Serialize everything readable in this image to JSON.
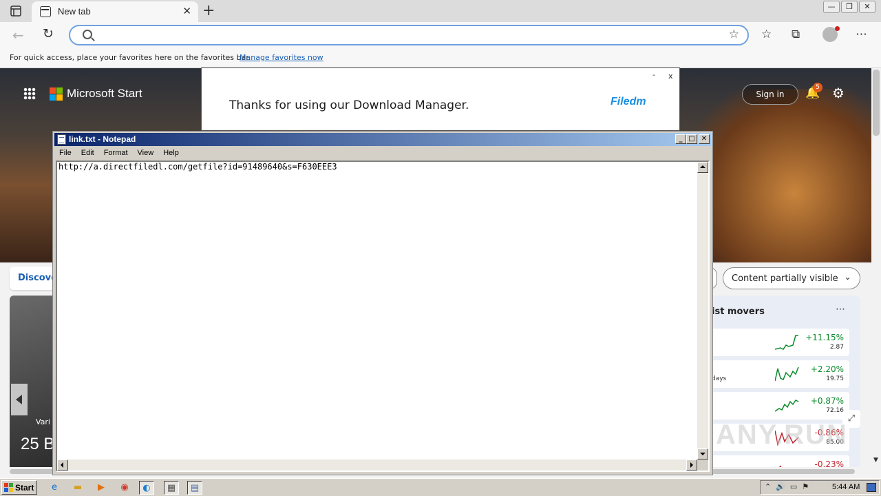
{
  "browser": {
    "tab_title": "New tab",
    "tab_close": "✕",
    "new_tab": "+",
    "address_placeholder": "",
    "favbar_text": "For quick access, place your favorites here on the favorites bar.",
    "favbar_link": "Manage favorites now"
  },
  "window_controls": {
    "minimize": "—",
    "restore": "❐",
    "close": "✕"
  },
  "start_page": {
    "brand": "Microsoft Start",
    "sign_in": "Sign in",
    "notification_count": "5",
    "discover_label": "Discove",
    "content_visibility": "Content partially visible",
    "card_source": "Vari",
    "card_headline": "25 B",
    "movers_title": "ist movers",
    "movers": [
      {
        "sub": "",
        "change": "+11.15%",
        "price": "2.87",
        "color": "#0a8a2a"
      },
      {
        "sub": "days",
        "change": "+2.20%",
        "price": "19.75",
        "color": "#0a8a2a"
      },
      {
        "sub": "",
        "change": "+0.87%",
        "price": "72.16",
        "color": "#0a8a2a"
      },
      {
        "sub": "",
        "change": "-0.86%",
        "price": "85.00",
        "color": "#c0202a"
      },
      {
        "sub": "",
        "change": "-0.23%",
        "price": "",
        "color": "#c0202a"
      }
    ],
    "watermark": "ANY.RUN"
  },
  "popup": {
    "message": "Thanks for using our Download Manager.",
    "brand": "Filedm",
    "minimize": "-",
    "close": "x"
  },
  "notepad": {
    "title": "link.txt - Notepad",
    "menu": [
      "File",
      "Edit",
      "Format",
      "View",
      "Help"
    ],
    "content": "http://a.directfiledl.com/getfile?id=91489640&s=F630EEE3",
    "btn_min": "_",
    "btn_max": "□",
    "btn_close": "✕"
  },
  "taskbar": {
    "start_label": "Start",
    "clock": "5:44 AM"
  }
}
